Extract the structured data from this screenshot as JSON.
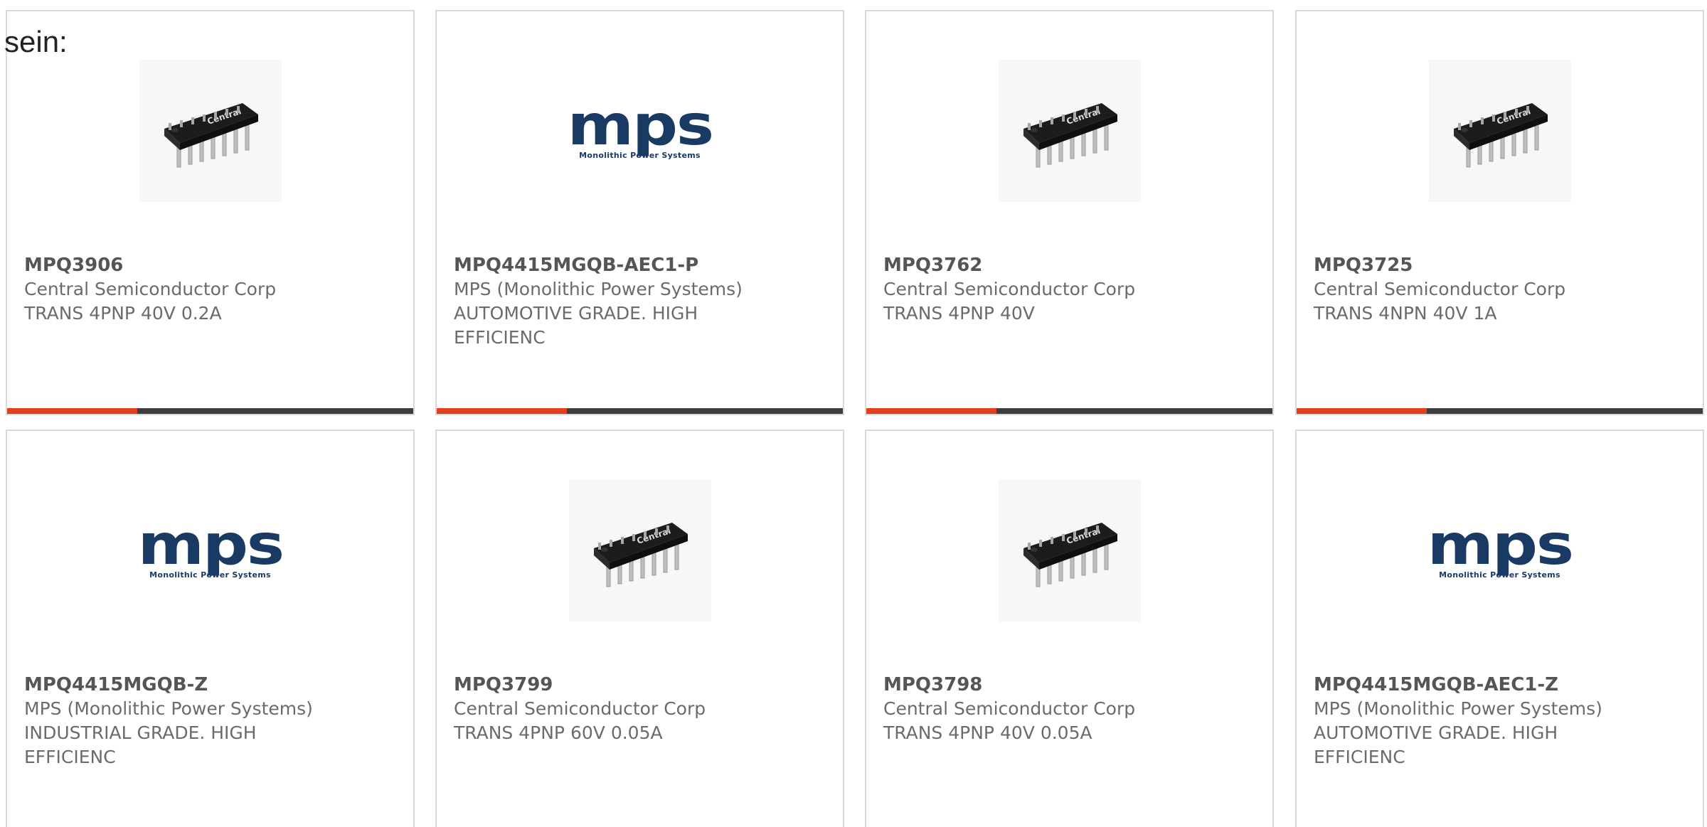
{
  "intro_text": "sein:",
  "colors": {
    "accent": "#e2401c",
    "bar": "#3d3d3d",
    "mps_blue": "#183a63"
  },
  "products": [
    {
      "part": "MPQ3906",
      "manufacturer": "Central Semiconductor Corp",
      "description": "TRANS 4PNP 40V 0.2A",
      "image": "chip-icon"
    },
    {
      "part": "MPQ4415MGQB-AEC1-P",
      "manufacturer": "MPS (Monolithic Power Systems)",
      "description": "AUTOMOTIVE GRADE. HIGH EFFICIENC",
      "image": "mps-logo"
    },
    {
      "part": "MPQ3762",
      "manufacturer": "Central Semiconductor Corp",
      "description": "TRANS 4PNP 40V",
      "image": "chip-icon"
    },
    {
      "part": "MPQ3725",
      "manufacturer": "Central Semiconductor Corp",
      "description": "TRANS 4NPN 40V 1A",
      "image": "chip-icon"
    },
    {
      "part": "MPQ4415MGQB-Z",
      "manufacturer": "MPS (Monolithic Power Systems)",
      "description": "INDUSTRIAL GRADE. HIGH EFFICIENC",
      "image": "mps-logo"
    },
    {
      "part": "MPQ3799",
      "manufacturer": "Central Semiconductor Corp",
      "description": "TRANS 4PNP 60V 0.05A",
      "image": "chip-icon"
    },
    {
      "part": "MPQ3798",
      "manufacturer": "Central Semiconductor Corp",
      "description": "TRANS 4PNP 40V 0.05A",
      "image": "chip-icon"
    },
    {
      "part": "MPQ4415MGQB-AEC1-Z",
      "manufacturer": "MPS (Monolithic Power Systems)",
      "description": "AUTOMOTIVE GRADE. HIGH EFFICIENC",
      "image": "mps-logo"
    }
  ],
  "logo": {
    "letters": "mps",
    "subtitle": "Monolithic Power Systems"
  },
  "chip_marking": "Central"
}
